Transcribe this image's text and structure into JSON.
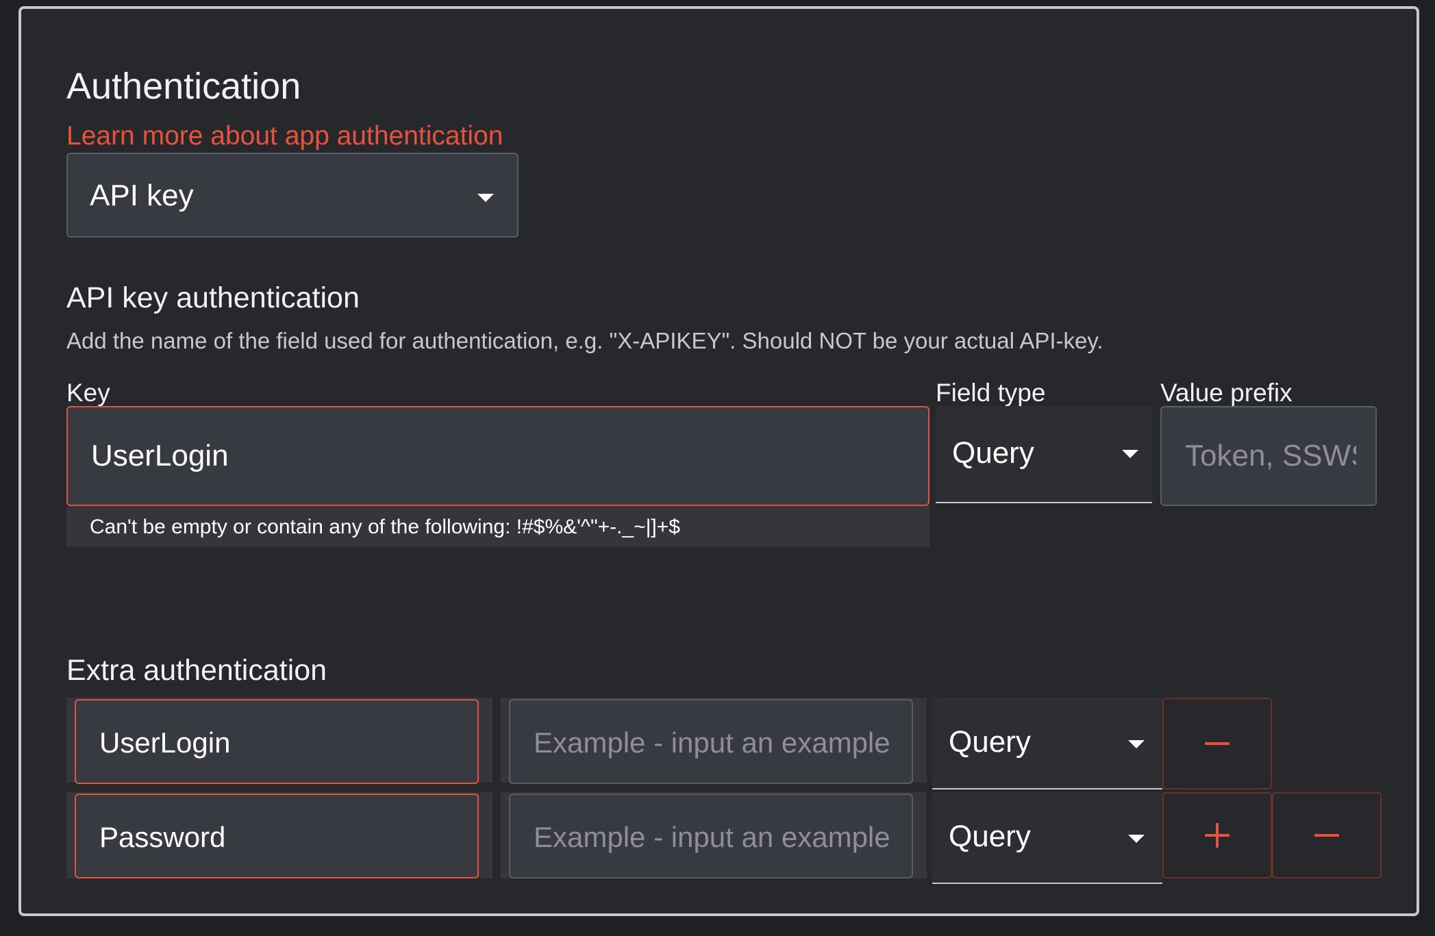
{
  "auth": {
    "title": "Authentication",
    "learn_more_link": "Learn more about app authentication",
    "auth_type_value": "API key"
  },
  "api_key_section": {
    "title": "API key authentication",
    "description": "Add the name of the field used for authentication, e.g. \"X-APIKEY\". Should NOT be your actual API-key.",
    "key_label": "Key",
    "key_value": "UserLogin",
    "key_hint": "Can't be empty or contain any of the following: !#$%&'^\"+-._~|]+$",
    "field_type_label": "Field type",
    "field_type_value": "Query",
    "value_prefix_label": "Value prefix",
    "value_prefix_placeholder": "Token, SSWS"
  },
  "extra_auth": {
    "title": "Extra authentication",
    "rows": [
      {
        "name": "UserLogin",
        "example_placeholder": "Example - input an example value",
        "type": "Query"
      },
      {
        "name": "Password",
        "example_placeholder": "Example - input an example value",
        "type": "Query"
      }
    ]
  },
  "colors": {
    "accent": "#e8523d",
    "background": "#27282c",
    "field_bg": "#373a40"
  },
  "icons": {
    "dropdown": "caret-down-icon",
    "add": "plus-icon",
    "remove": "minus-icon"
  }
}
